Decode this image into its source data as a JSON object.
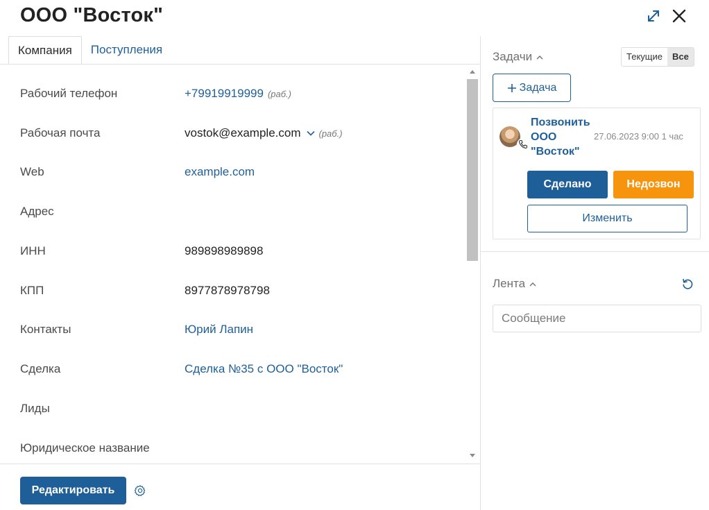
{
  "window": {
    "title": "ООО \"Восток\""
  },
  "tabs": [
    {
      "label": "Компания",
      "active": true
    },
    {
      "label": "Поступления",
      "active": false
    }
  ],
  "fields": [
    {
      "label": "Рабочий телефон",
      "value": "+79919919999",
      "tag": "(раб.)",
      "link": true,
      "dropdown": false
    },
    {
      "label": "Рабочая почта",
      "value": "vostok@example.com",
      "tag": "(раб.)",
      "link": false,
      "dropdown": true
    },
    {
      "label": "Web",
      "value": "example.com",
      "tag": "",
      "link": true,
      "dropdown": false
    },
    {
      "label": "Адрес",
      "value": "",
      "tag": "",
      "link": false,
      "dropdown": false
    },
    {
      "label": "ИНН",
      "value": "989898989898",
      "tag": "",
      "link": false,
      "dropdown": false
    },
    {
      "label": "КПП",
      "value": "8977878978798",
      "tag": "",
      "link": false,
      "dropdown": false
    },
    {
      "label": "Контакты",
      "value": "Юрий Лапин",
      "tag": "",
      "link": true,
      "dropdown": false
    },
    {
      "label": "Сделка",
      "value": "Сделка №35 с ООО \"Восток\"",
      "tag": "",
      "link": true,
      "dropdown": false
    },
    {
      "label": "Лиды",
      "value": "",
      "tag": "",
      "link": false,
      "dropdown": false
    },
    {
      "label": "Юридическое название",
      "value": "",
      "tag": "",
      "link": false,
      "dropdown": false
    }
  ],
  "footer": {
    "edit_label": "Редактировать"
  },
  "tasks": {
    "title": "Задачи",
    "filter_current": "Текущие",
    "filter_all": "Все",
    "add_label": "Задача",
    "item": {
      "title": "Позвонить ООО \"Восток\"",
      "date": "27.06.2023 9:00 1 час",
      "done_label": "Сделано",
      "noanswer_label": "Недозвон",
      "change_label": "Изменить"
    }
  },
  "feed": {
    "title": "Лента",
    "message_placeholder": "Сообщение"
  },
  "colors": {
    "accent": "#1f5f99",
    "warning": "#f7940d",
    "border": "#e2e2e2"
  },
  "icons": [
    "expand-icon",
    "close-icon",
    "chevron-down-icon",
    "gear-icon",
    "chevron-up-icon",
    "plus-icon",
    "phone-icon",
    "refresh-icon"
  ]
}
